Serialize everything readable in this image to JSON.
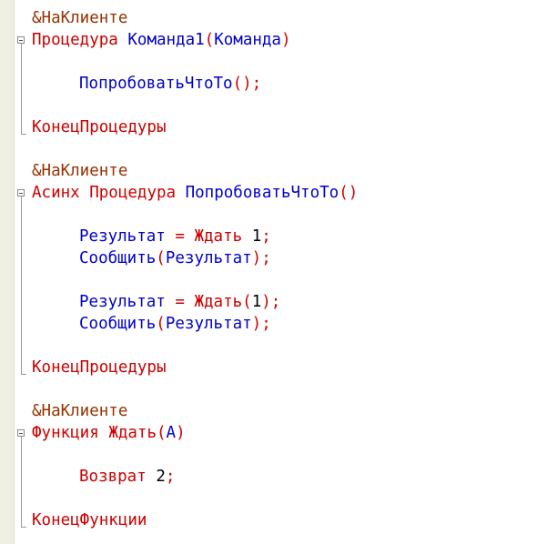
{
  "editor": {
    "blocks": [
      {
        "directive": "&НаКлиенте",
        "header": {
          "kw1": "Процедура",
          "name": "Команда1",
          "lp": "(",
          "param": "Команда",
          "rp": ")"
        },
        "body": [
          {
            "call": "ПопробоватьЧтоТо",
            "lp": "(",
            "rp": ")",
            "semi": ";"
          }
        ],
        "end": "КонецПроцедуры"
      },
      {
        "directive": "&НаКлиенте",
        "header": {
          "kw0": "Асинх",
          "kw1": "Процедура",
          "name": "ПопробоватьЧтоТо",
          "lp": "(",
          "rp": ")"
        },
        "body": [
          {
            "lhs": "Результат",
            "eq": "=",
            "fn": "Ждать",
            "arg": "1",
            "semi": ";"
          },
          {
            "call": "Сообщить",
            "lp": "(",
            "param": "Результат",
            "rp": ")",
            "semi": ";"
          },
          {
            "lhs": "Результат",
            "eq": "=",
            "fn": "Ждать",
            "lp": "(",
            "arg": "1",
            "rp": ")",
            "semi": ";"
          },
          {
            "call": "Сообщить",
            "lp": "(",
            "param": "Результат",
            "rp": ")",
            "semi": ";"
          }
        ],
        "end": "КонецПроцедуры"
      },
      {
        "directive": "&НаКлиенте",
        "header": {
          "kw1": "Функция",
          "name": "Ждать",
          "lp": "(",
          "param": "А",
          "rp": ")"
        },
        "body": [
          {
            "kw": "Возврат",
            "arg": "2",
            "semi": ";"
          }
        ],
        "end": "КонецФункции"
      }
    ]
  }
}
